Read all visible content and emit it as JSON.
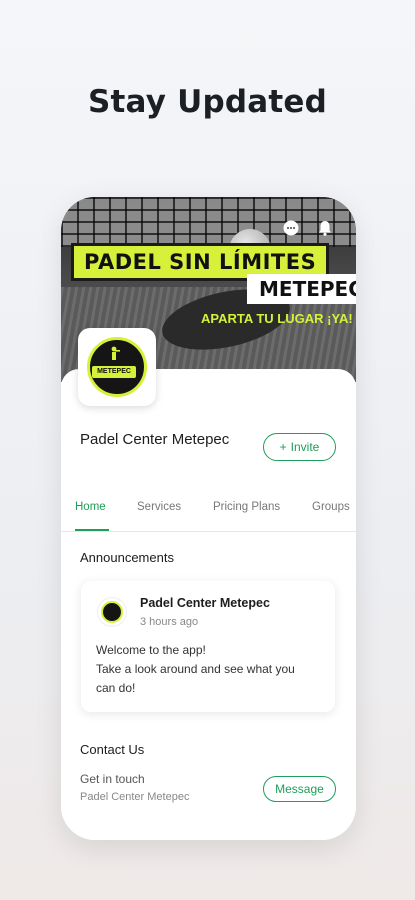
{
  "headline": "Stay Updated",
  "cover": {
    "banner_line1": "PADEL SIN LÍMITES",
    "banner_line2": "METEPEC",
    "tagline": "APARTA TU LUGAR ¡YA!"
  },
  "profile": {
    "name": "Padel Center Metepec",
    "logo_text": "METEPEC",
    "invite_label": "Invite",
    "invite_icon": "+"
  },
  "tabs": [
    {
      "label": "Home",
      "active": true
    },
    {
      "label": "Services",
      "active": false
    },
    {
      "label": "Pricing Plans",
      "active": false
    },
    {
      "label": "Groups",
      "active": false
    }
  ],
  "announcements": {
    "title": "Announcements",
    "post": {
      "author": "Padel Center Metepec",
      "time": "3 hours ago",
      "lines": [
        "Welcome to the app!",
        "Take a look around and see what you",
        "can do!"
      ]
    }
  },
  "contact": {
    "title": "Contact Us",
    "subtitle": "Get in touch",
    "org": "Padel Center Metepec",
    "message_label": "Message"
  },
  "colors": {
    "accent": "#1e9e5a",
    "brand_yellow": "#d7f03a"
  },
  "icons": {
    "top": [
      "chat-icon",
      "bell-icon"
    ]
  }
}
